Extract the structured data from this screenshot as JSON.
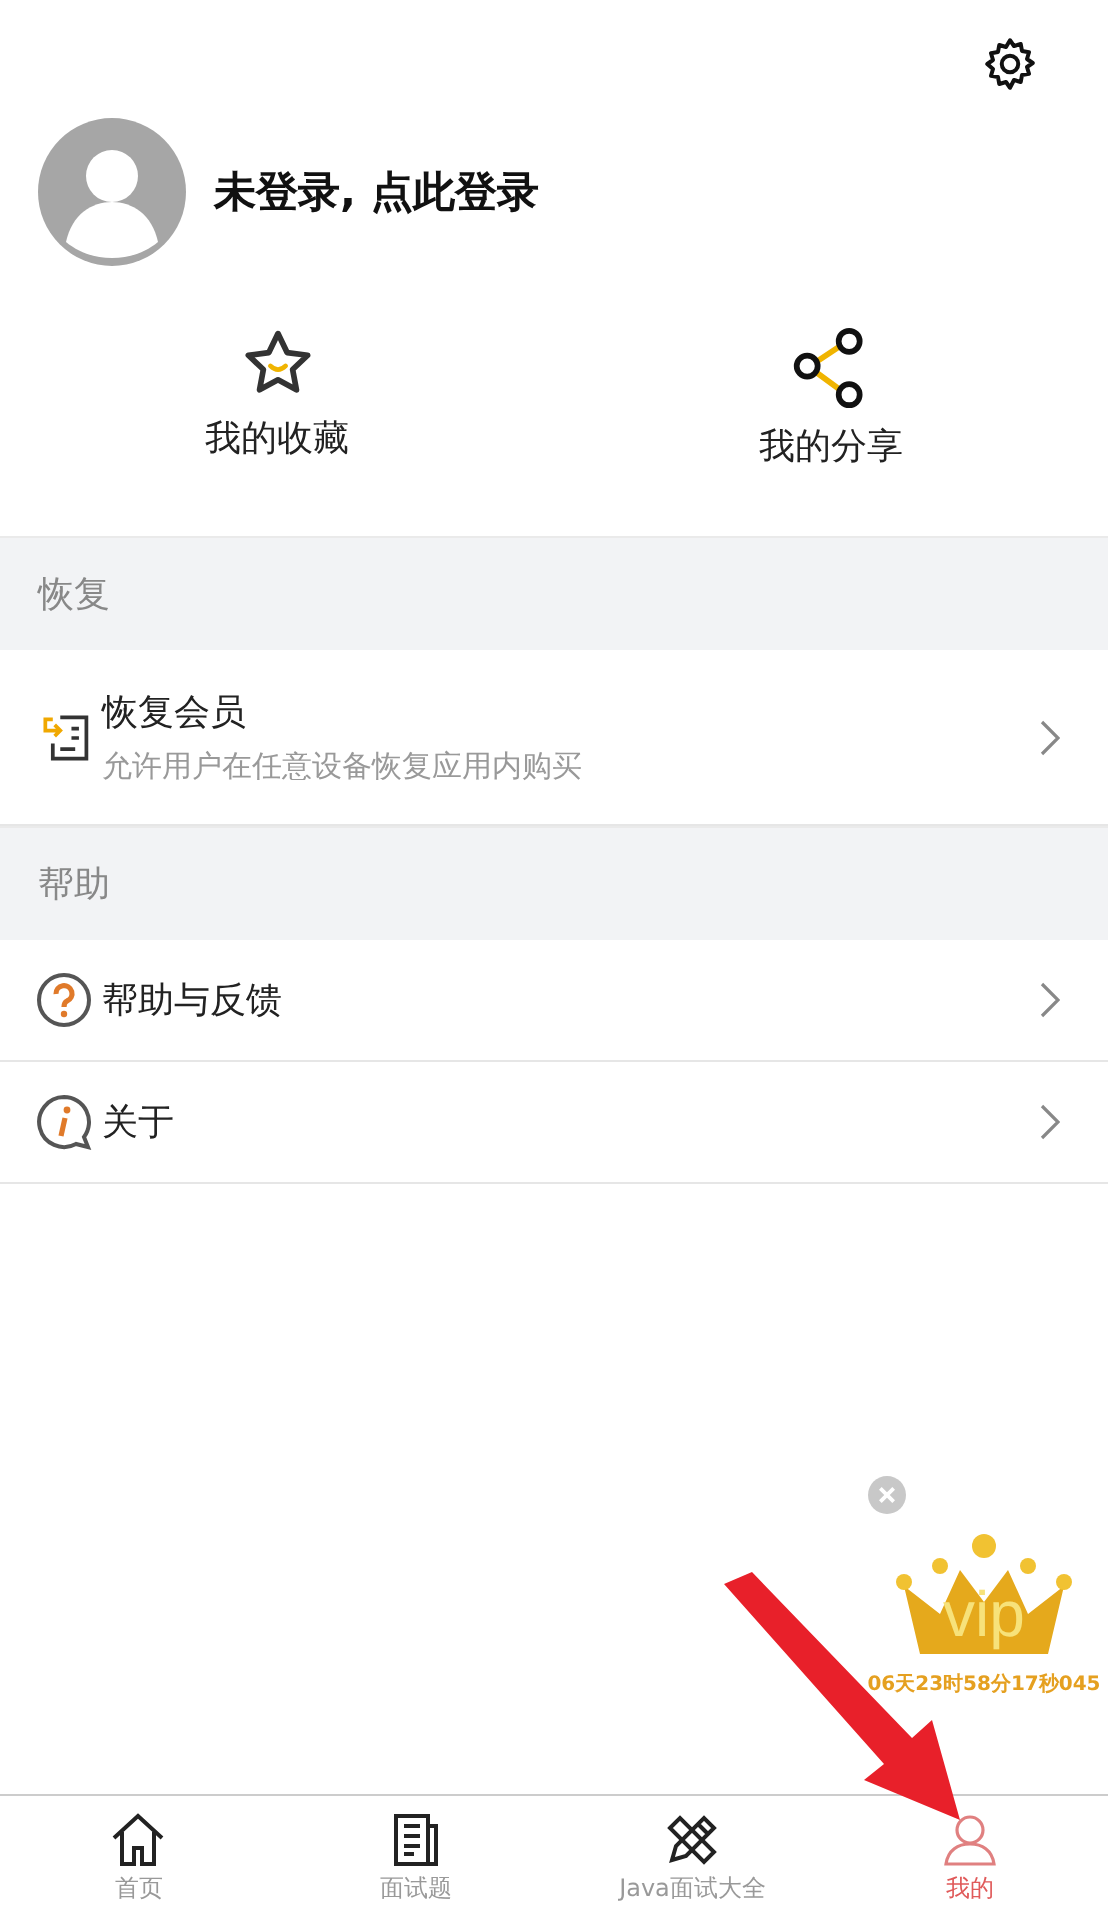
{
  "profile": {
    "login_prompt": "未登录, 点此登录"
  },
  "shortcuts": [
    {
      "kind": "favorite",
      "label": "我的收藏"
    },
    {
      "kind": "share",
      "label": "我的分享"
    }
  ],
  "sections": [
    {
      "title": "恢复",
      "items": [
        {
          "kind": "restore",
          "title": "恢复会员",
          "subtitle": "允许用户在任意设备恢复应用内购买"
        }
      ]
    },
    {
      "title": "帮助",
      "items": [
        {
          "kind": "help",
          "title": "帮助与反馈"
        },
        {
          "kind": "info",
          "title": "关于"
        }
      ]
    }
  ],
  "vip_badge": {
    "logo": "vip",
    "countdown": "06天23时58分17秒045"
  },
  "tabs": [
    {
      "kind": "home",
      "label": "首页",
      "selected": false
    },
    {
      "kind": "news",
      "label": "面试题",
      "selected": false
    },
    {
      "kind": "tools",
      "label": "Java面试大全",
      "selected": false
    },
    {
      "kind": "user",
      "label": "我的",
      "selected": true
    }
  ]
}
